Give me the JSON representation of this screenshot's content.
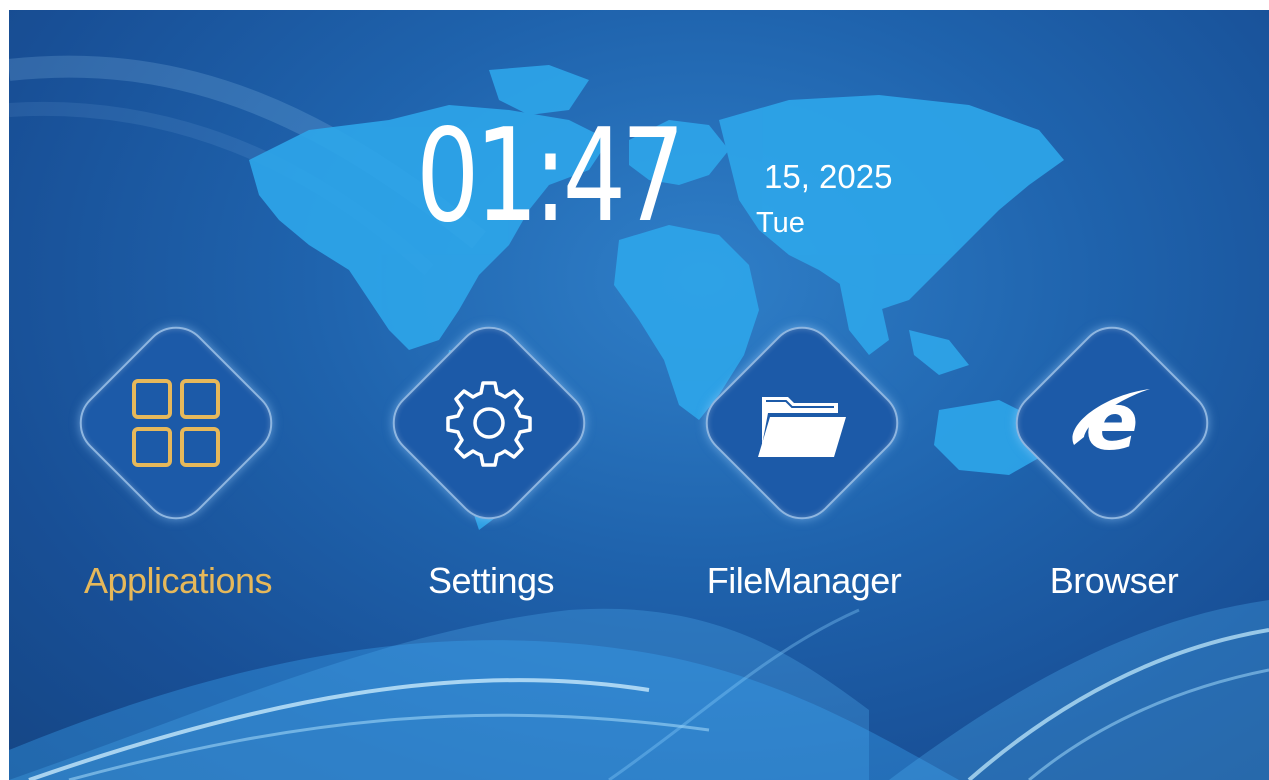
{
  "clock": {
    "time": "01:47",
    "date": "15, 2025",
    "weekday": "Tue"
  },
  "launcher": {
    "items": [
      {
        "label": "Applications",
        "icon": "apps-grid-icon",
        "active": true
      },
      {
        "label": "Settings",
        "icon": "gear-icon",
        "active": false
      },
      {
        "label": "FileManager",
        "icon": "folder-icon",
        "active": false
      },
      {
        "label": "Browser",
        "icon": "browser-e-icon",
        "active": false
      }
    ]
  },
  "colors": {
    "background": "#1f63ad",
    "tile": "#1c5aa8",
    "active_label": "#e6b85a",
    "map": "#2fa8e8"
  }
}
